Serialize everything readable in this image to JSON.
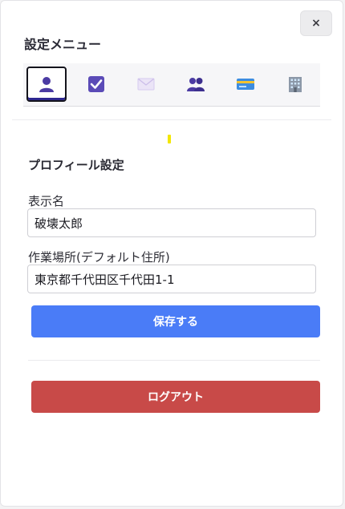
{
  "menu": {
    "title": "設定メニュー",
    "close_label": "×"
  },
  "tabs": [
    {
      "icon": "person-icon",
      "active": true
    },
    {
      "icon": "checkbox-icon",
      "active": false
    },
    {
      "icon": "envelope-icon",
      "active": false
    },
    {
      "icon": "people-icon",
      "active": false
    },
    {
      "icon": "credit-card-icon",
      "active": false
    },
    {
      "icon": "office-building-icon",
      "active": false
    }
  ],
  "profile": {
    "section_title": "プロフィール設定",
    "display_name_label": "表示名",
    "display_name_value": "破壊太郎",
    "workplace_label": "作業場所(デフォルト住所)",
    "workplace_value": "東京都千代田区千代田1-1",
    "save_label": "保存する"
  },
  "logout_label": "ログアウト",
  "colors": {
    "primary": "#4a7cf7",
    "danger": "#c84a48",
    "icon_purple": "#4b3ba3",
    "indicator_yellow": "#f3e600"
  }
}
